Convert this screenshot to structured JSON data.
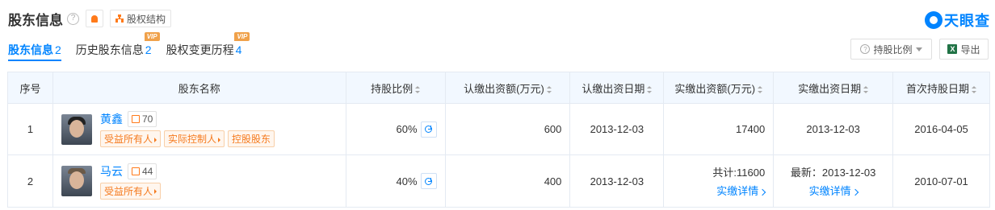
{
  "header": {
    "title": "股东信息",
    "help_glyph": "?",
    "structure_label": "股权结构",
    "logo_text": "天眼查",
    "accent": "#0084ff",
    "warn": "#ff7a1a"
  },
  "tabs": [
    {
      "label": "股东信息",
      "count": "2",
      "vip": "",
      "active": true
    },
    {
      "label": "历史股东信息",
      "count": "2",
      "vip": "VIP"
    },
    {
      "label": "股权变更历程",
      "count": "4",
      "vip": "VIP"
    }
  ],
  "toolbar": {
    "ratio_label": "持股比例",
    "export_label": "导出",
    "export_icon_text": "X"
  },
  "table": {
    "headers": [
      "序号",
      "股东名称",
      "持股比例",
      "认缴出资额(万元)",
      "认缴出资日期",
      "实缴出资额(万元)",
      "实缴出资日期",
      "首次持股日期"
    ],
    "rows": [
      {
        "index": "1",
        "name": "黄鑫",
        "related_count": "70",
        "tags": [
          "受益所有人",
          "实际控制人",
          "控股股东"
        ],
        "ratio": "60%",
        "subscribed_amount": "600",
        "subscribed_date": "2013-12-03",
        "paid_amount": "17400",
        "paid_date": "2013-12-03",
        "first_hold_date": "2016-04-05"
      },
      {
        "index": "2",
        "name": "马云",
        "related_count": "44",
        "tags": [
          "受益所有人"
        ],
        "ratio": "40%",
        "subscribed_amount": "400",
        "subscribed_date": "2013-12-03",
        "paid_amount": "共计:11600",
        "paid_detail_link": "实缴详情",
        "paid_date": "最新：2013-12-03",
        "paid_date_link": "实缴详情",
        "first_hold_date": "2010-07-01"
      }
    ]
  }
}
